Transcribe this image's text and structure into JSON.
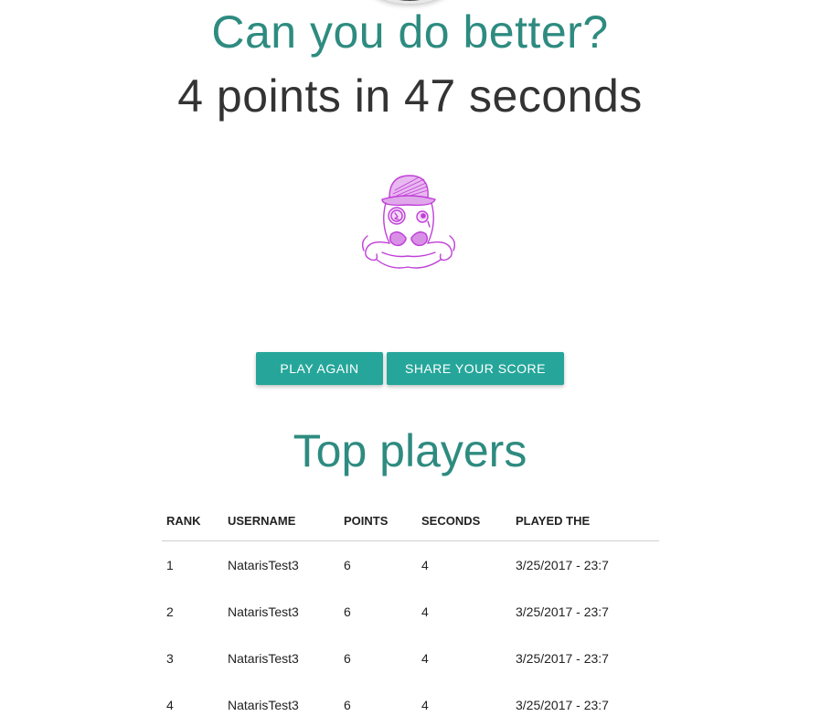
{
  "challenge_title": "Can you do better?",
  "score_summary": "4 points in 47 seconds",
  "buttons": {
    "play_again": "PLAY AGAIN",
    "share_score": "SHARE YOUR SCORE"
  },
  "leaderboard": {
    "title": "Top players",
    "columns": [
      "RANK",
      "USERNAME",
      "POINTS",
      "SECONDS",
      "PLAYED THE"
    ],
    "rows": [
      [
        "1",
        "NatarisTest3",
        "6",
        "4",
        "3/25/2017 - 23:7"
      ],
      [
        "2",
        "NatarisTest3",
        "6",
        "4",
        "3/25/2017 - 23:7"
      ],
      [
        "3",
        "NatarisTest3",
        "6",
        "4",
        "3/25/2017 - 23:7"
      ],
      [
        "4",
        "NatarisTest3",
        "6",
        "4",
        "3/25/2017 - 23:7"
      ]
    ]
  },
  "colors": {
    "accent_teal": "#2e8b80",
    "button_teal": "#26a69a",
    "mascot_purple": "#c040d8"
  },
  "icons": {
    "mascot": "octopus-gentleman-icon",
    "top_avatar": "avatar-icon"
  }
}
